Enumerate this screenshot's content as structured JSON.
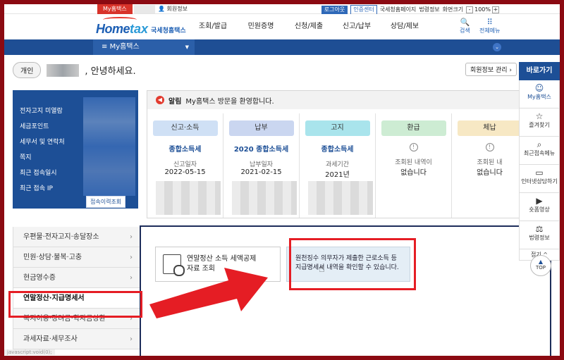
{
  "util": {
    "mytax": "My홈택스",
    "member_info": "회원정보",
    "logout": "로그아웃",
    "cert_center": "인증센터",
    "nts_home": "국세청홈페이지",
    "law_info": "법령정보",
    "screen_size": "화면크기",
    "zoom_minus": "-",
    "zoom_value": "100%",
    "zoom_plus": "+"
  },
  "header": {
    "logo_main": "Home",
    "logo_tax": "tax",
    "logo_kr": "국세청홈택스",
    "menu": [
      "조회/발급",
      "민원증명",
      "신청/제출",
      "신고/납부",
      "상담/제보"
    ],
    "search": "검색",
    "all_menu": "전체메뉴"
  },
  "bluebar": {
    "dropdown": "My홈택스"
  },
  "greeting": {
    "type_badge": "개인",
    "text": ", 안녕하세요.",
    "member_mgmt": "회원정보 관리"
  },
  "left_panel": {
    "items": [
      "전자고지 미열람",
      "세금포인트",
      "세무서 및 연락처",
      "쪽지",
      "최근 접속일시",
      "최근 접속 IP"
    ],
    "history_button": "접속이력조회"
  },
  "notice": {
    "label": "알림",
    "message": "My홈택스 방문을 환영합니다."
  },
  "cards": [
    {
      "tag": "신고·소득",
      "title": "종합소득세",
      "label": "신고일자",
      "value": "2022-05-15",
      "color": "#cfe0f5"
    },
    {
      "tag": "납부",
      "title": "2020 종합소득세",
      "label": "납부일자",
      "value": "2021-02-15",
      "color": "#cad6f0"
    },
    {
      "tag": "고지",
      "title": "종합소득세",
      "label": "과세기간",
      "value": "2021년",
      "color": "#a9e4ec"
    },
    {
      "tag": "환급",
      "title": "",
      "label": "조회된 내역이",
      "value": "없습니다",
      "color": "#cdecd3"
    },
    {
      "tag": "체납",
      "title": "",
      "label": "조회된 내",
      "value": "없습니다",
      "color": "#f7e8c4"
    }
  ],
  "menu_list": [
    "우편물·전자고지·송달장소",
    "민원·상담·불복·고충",
    "현금영수증",
    "연말정산·지급명세서",
    "복지이용·장려금·학자금상환",
    "과세자료·세무조사"
  ],
  "services": {
    "svc1_line1": "연말정산 소득 세액공제",
    "svc1_line2": "자료 조회",
    "svc2_line1": "원천징수 의무자가 제출한 근로소득 등",
    "svc2_line2": "지급명세서 내역을 확인할 수 있습니다."
  },
  "quickbar": {
    "title": "바로가기",
    "items": [
      "My홈택스",
      "즐겨찾기",
      "최근접속메뉴",
      "인터넷상담하기",
      "숏폼영상",
      "법령정보"
    ],
    "fold": "접기 ^",
    "top": "TOP"
  },
  "statusbar": "javascript:void(0);"
}
